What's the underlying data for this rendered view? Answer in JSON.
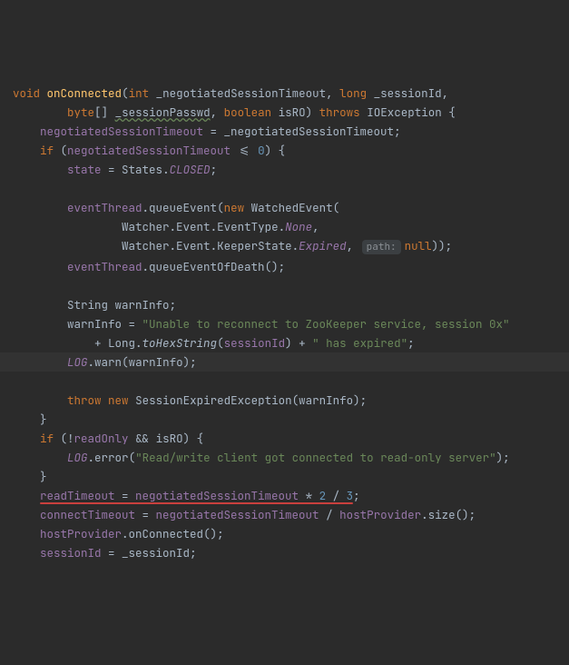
{
  "code": {
    "l1": {
      "kw_void": "void",
      "fn": "onConnected",
      "p_int": "int",
      "p1": "_negotiatedSessionTimeout",
      "p_long": "long",
      "p2": "_sessionId"
    },
    "l2": {
      "p_byte": "byte",
      "br": "[]",
      "p3": "_sessionPasswd",
      "p_bool": "boolean",
      "p4": "isRO",
      "throws": "throws",
      "exc": "IOException"
    },
    "l3": {
      "lhs": "negotiatedSessionTimeout",
      "rhs": "_negotiatedSessionTimeout"
    },
    "l4": {
      "kw_if": "if",
      "cond_lhs": "negotiatedSessionTimeout",
      "op": "<=",
      "zero": "0"
    },
    "l5": {
      "state": "state",
      "cls": "States",
      "val": "CLOSED"
    },
    "l7": {
      "obj": "eventThread",
      "m": "queueEvent",
      "kw_new": "new",
      "cls": "WatchedEvent"
    },
    "l8": {
      "a": "Watcher",
      "b": "Event",
      "c": "EventType",
      "d": "None"
    },
    "l9": {
      "a": "Watcher",
      "b": "Event",
      "c": "KeeperState",
      "d": "Expired",
      "hint": "path:",
      "nul": "null"
    },
    "l10": {
      "obj": "eventThread",
      "m": "queueEventOfDeath"
    },
    "l12": {
      "t": "String",
      "v": "warnInfo"
    },
    "l13": {
      "v": "warnInfo",
      "s": "\"Unable to reconnect to ZooKeeper service, session 0x\""
    },
    "l14": {
      "a": "Long",
      "m": "toHexString",
      "arg": "sessionId",
      "s": "\" has expired\""
    },
    "l15": {
      "obj": "LOG",
      "m": "warn",
      "arg": "warnInfo"
    },
    "l16": {
      "kw_throw": "throw",
      "kw_new": "new",
      "cls": "SessionExpiredException",
      "arg": "warnInfo"
    },
    "l18": {
      "kw_if": "if",
      "f1": "readOnly",
      "v": "isRO"
    },
    "l19": {
      "obj": "LOG",
      "m": "error",
      "s": "\"Read/write client got connected to read-only server\""
    },
    "l21": {
      "lhs": "readTimeout",
      "rhs": "negotiatedSessionTimeout",
      "n1": "2",
      "n2": "3"
    },
    "l22": {
      "lhs": "connectTimeout",
      "rhs": "negotiatedSessionTimeout",
      "obj": "hostProvider",
      "m": "size"
    },
    "l23": {
      "obj": "hostProvider",
      "m": "onConnected"
    },
    "l24": {
      "lhs": "sessionId",
      "rhs": "_sessionId"
    }
  }
}
